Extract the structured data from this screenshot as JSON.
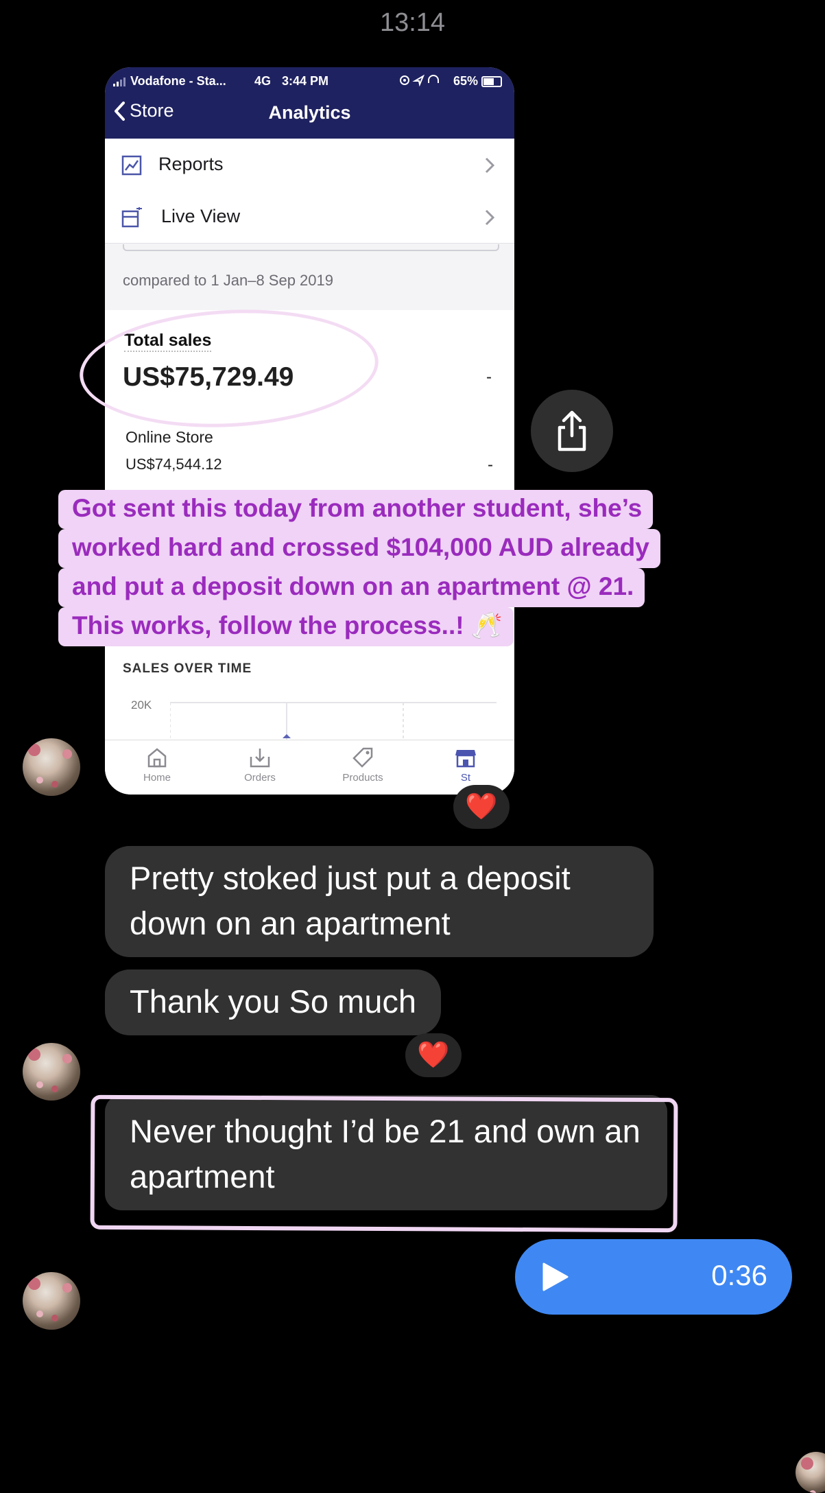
{
  "status_bar": {
    "time": "13:14"
  },
  "shared_screenshot": {
    "phone_status": {
      "carrier": "Vodafone - Sta...",
      "network": "4G",
      "time": "3:44 PM",
      "battery": "65%"
    },
    "nav": {
      "back_label": "Store",
      "title": "Analytics"
    },
    "menu": [
      {
        "label": "Reports",
        "icon": "reports-icon"
      },
      {
        "label": "Live View",
        "icon": "live-view-icon"
      }
    ],
    "compared_text": "compared to 1 Jan–8 Sep 2019",
    "total_sales": {
      "label": "Total sales",
      "value": "US$75,729.49",
      "change": "-"
    },
    "online_store": {
      "label": "Online Store",
      "value": "US$74,544.12",
      "change": "-"
    },
    "sales_over_time": {
      "title": "SALES OVER TIME",
      "tick": "20K"
    },
    "tabs": [
      {
        "label": "Home",
        "icon": "home-icon"
      },
      {
        "label": "Orders",
        "icon": "orders-icon"
      },
      {
        "label": "Products",
        "icon": "products-icon"
      },
      {
        "label": "St",
        "icon": "store-icon"
      }
    ]
  },
  "caption": {
    "lines": [
      "Got sent this today from another student, she’s",
      "worked hard and crossed $104,000 AUD already",
      "and put a deposit down on an apartment @ 21.",
      "This works, follow the process..! 🥂"
    ],
    "text_color": "#9a2bbd",
    "bg_color": "#f0d3f6"
  },
  "messages": [
    {
      "text": "Pretty stoked just put a deposit down on an apartment"
    },
    {
      "text": "Thank you So much",
      "reaction": "❤️"
    },
    {
      "text": "Never thought I’d be 21 and own an apartment"
    }
  ],
  "image_reaction": "❤️",
  "audio_message": {
    "duration": "0:36",
    "color": "#3f88f3"
  }
}
